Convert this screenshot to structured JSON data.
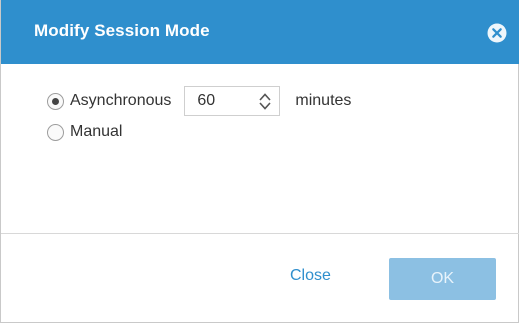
{
  "dialog": {
    "title": "Modify Session Mode",
    "close_icon": "close-circle-icon"
  },
  "mode": {
    "asynchronous_label": "Asynchronous",
    "asynchronous_selected": true,
    "minutes_value": "60",
    "minutes_unit": "minutes",
    "manual_label": "Manual",
    "manual_selected": false
  },
  "footer": {
    "close_label": "Close",
    "ok_label": "OK",
    "ok_enabled": false
  },
  "colors": {
    "header": "#2f8fcd",
    "link": "#2f8fcd",
    "ok_disabled": "#8cc0e3"
  }
}
